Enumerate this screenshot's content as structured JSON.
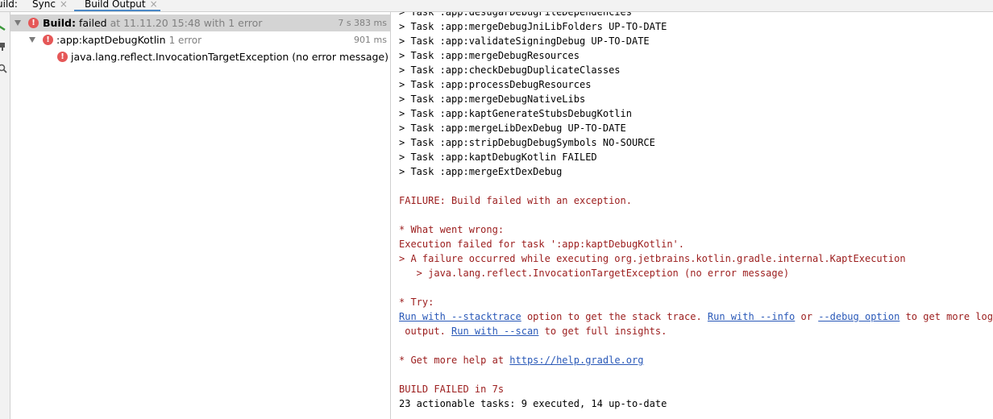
{
  "tabs": {
    "build_label": "uild:",
    "sync_label": "Sync",
    "build_output_label": "Build Output",
    "close_glyph": "×"
  },
  "tree": {
    "root": {
      "label": "Build:",
      "status": "failed",
      "detail": "at 11.11.20 15:48 with 1 error",
      "time": "7 s 383 ms"
    },
    "task": {
      "label": ":app:kaptDebugKotlin",
      "detail": "1 error",
      "time": "901 ms"
    },
    "error": {
      "label": "java.lang.reflect.InvocationTargetException (no error message)"
    }
  },
  "console": {
    "tasks": [
      "> Task :app:desugarDebugFileDependencies",
      "> Task :app:mergeDebugJniLibFolders UP-TO-DATE",
      "> Task :app:validateSigningDebug UP-TO-DATE",
      "> Task :app:mergeDebugResources",
      "> Task :app:checkDebugDuplicateClasses",
      "> Task :app:processDebugResources",
      "> Task :app:mergeDebugNativeLibs",
      "> Task :app:kaptGenerateStubsDebugKotlin",
      "> Task :app:mergeLibDexDebug UP-TO-DATE",
      "> Task :app:stripDebugDebugSymbols NO-SOURCE",
      "> Task :app:kaptDebugKotlin FAILED",
      "> Task :app:mergeExtDexDebug"
    ],
    "failure": "FAILURE: Build failed with an exception.",
    "wrong_heading": "* What went wrong:",
    "wrong_line1": "Execution failed for task ':app:kaptDebugKotlin'.",
    "wrong_line2": "> A failure occurred while executing org.jetbrains.kotlin.gradle.internal.KaptExecution",
    "wrong_line3": "   > java.lang.reflect.InvocationTargetException (no error message)",
    "try_heading": "* Try:",
    "try_link1": "Run with --stacktrace",
    "try_text1": " option to get the stack trace. ",
    "try_link2": "Run with --info",
    "try_text2": " or ",
    "try_link3": "--debug option",
    "try_text3": " to get more log",
    "try_text4": " output. ",
    "try_link4": "Run with --scan",
    "try_text5": " to get full insights.",
    "help_text": "* Get more help at ",
    "help_link": "https://help.gradle.org",
    "build_failed": "BUILD FAILED in 7s",
    "summary": "23 actionable tasks: 9 executed, 14 up-to-date"
  },
  "colors": {
    "error_red": "#9b1c1c",
    "link_blue": "#2a59b8",
    "error_icon": "#e55757",
    "selection": "#d4d4d4"
  }
}
